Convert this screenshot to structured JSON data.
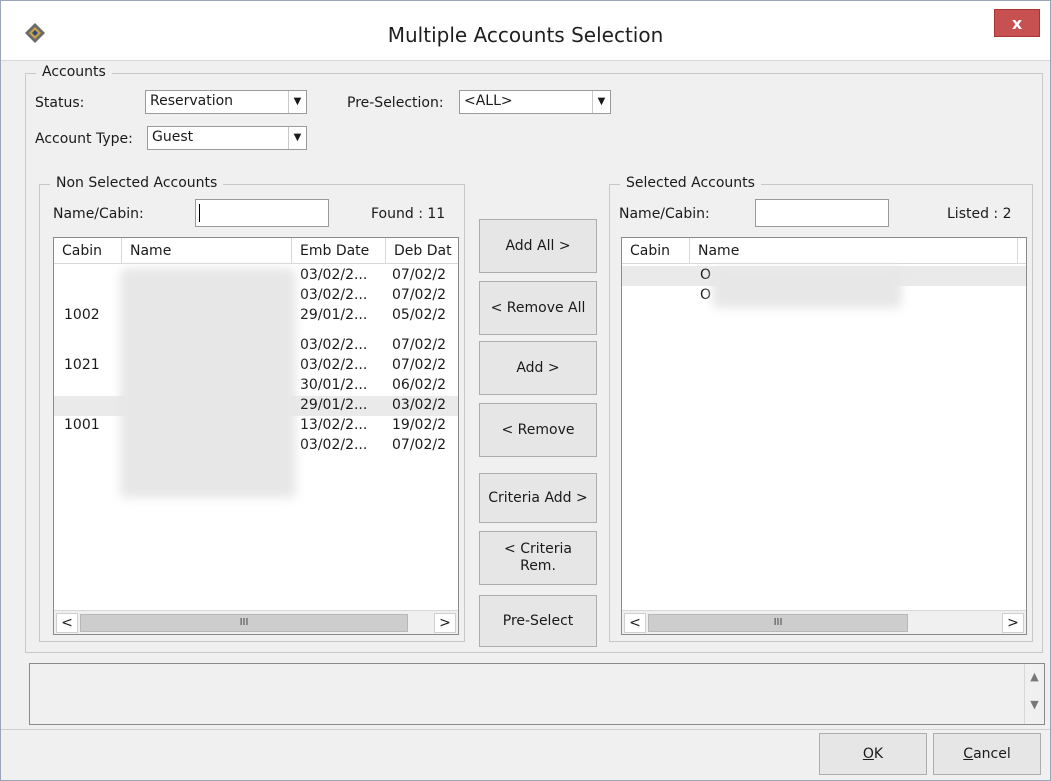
{
  "window": {
    "title": "Multiple Accounts Selection",
    "close_label": "x"
  },
  "accounts": {
    "legend": "Accounts",
    "status_label": "Status:",
    "status_value": "Reservation",
    "preselection_label": "Pre-Selection:",
    "preselection_value": "<ALL>",
    "account_type_label": "Account Type:",
    "account_type_value": "Guest"
  },
  "non_selected": {
    "legend": "Non Selected Accounts",
    "name_cabin_label": "Name/Cabin:",
    "search_value": "",
    "found_text": "Found : 11",
    "columns": [
      "Cabin",
      "Name",
      "Emb Date",
      "Deb Dat"
    ],
    "rows": [
      {
        "cabin": "",
        "emb": "03/02/2...",
        "deb": "07/02/2"
      },
      {
        "cabin": "",
        "emb": "03/02/2...",
        "deb": "07/02/2"
      },
      {
        "cabin": "1002",
        "emb": "29/01/2...",
        "deb": "05/02/2"
      },
      {
        "cabin": "",
        "emb": "03/02/2...",
        "deb": "07/02/2"
      },
      {
        "cabin": "1021",
        "emb": "03/02/2...",
        "deb": "07/02/2"
      },
      {
        "cabin": "",
        "emb": "30/01/2...",
        "deb": "06/02/2"
      },
      {
        "cabin": "",
        "emb": "29/01/2...",
        "deb": "03/02/2"
      },
      {
        "cabin": "1001",
        "emb": "13/02/2...",
        "deb": "19/02/2"
      },
      {
        "cabin": "",
        "emb": "03/02/2...",
        "deb": "07/02/2"
      }
    ]
  },
  "buttons": {
    "add_all": "Add All >",
    "remove_all": "< Remove All",
    "add": "Add >",
    "remove": "< Remove",
    "criteria_add": "Criteria Add >",
    "criteria_rem_line1": "< Criteria",
    "criteria_rem_line2": "Rem.",
    "pre_select": "Pre-Select"
  },
  "selected": {
    "legend": "Selected Accounts",
    "name_cabin_label": "Name/Cabin:",
    "search_value": "",
    "listed_text": "Listed : 2",
    "columns": [
      "Cabin",
      "Name"
    ],
    "rows": [
      {
        "cabin": "",
        "name": "O"
      },
      {
        "cabin": "",
        "name": "O"
      }
    ]
  },
  "scrollbar": {
    "left": "<",
    "right": ">",
    "grip": "III"
  },
  "footer": {
    "ok_label": "OK",
    "ok_mnemonic": "O",
    "ok_rest": "K",
    "cancel_mnemonic": "C",
    "cancel_rest": "ancel"
  },
  "icons": {
    "app": "ship-wheel-icon",
    "close": "close-icon"
  }
}
